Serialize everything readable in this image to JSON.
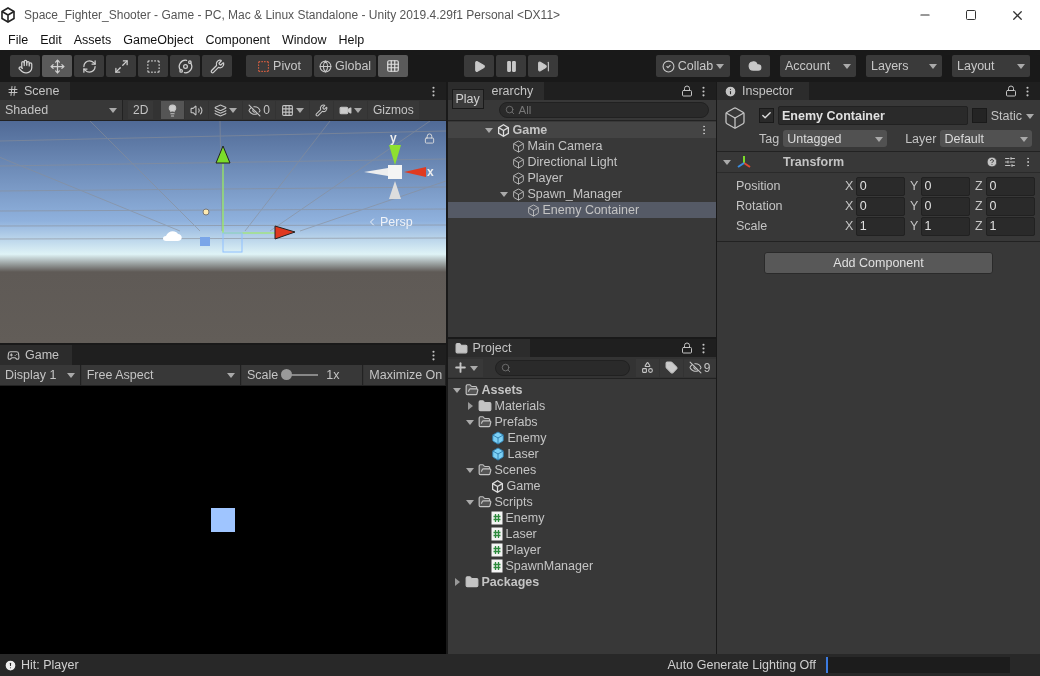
{
  "window": {
    "title": "Space_Fighter_Shooter - Game - PC, Mac & Linux Standalone - Unity 2019.4.29f1 Personal <DX11>"
  },
  "menu": [
    "File",
    "Edit",
    "Assets",
    "GameObject",
    "Component",
    "Window",
    "Help"
  ],
  "toolbar": {
    "tools": [
      {
        "kind": "hand",
        "selected": false
      },
      {
        "kind": "move",
        "selected": true
      },
      {
        "kind": "rotate",
        "selected": false
      },
      {
        "kind": "scale",
        "selected": false
      },
      {
        "kind": "rect",
        "selected": false
      },
      {
        "kind": "transform",
        "selected": false
      },
      {
        "kind": "custom",
        "selected": false
      }
    ],
    "pivot": "Pivot",
    "global": "Global",
    "snap": {
      "selected": true
    },
    "play": [
      {
        "kind": "play"
      },
      {
        "kind": "pause"
      },
      {
        "kind": "step"
      }
    ],
    "collab": "Collab",
    "account": "Account",
    "layers": "Layers",
    "layout": "Layout"
  },
  "tooltip": "Play",
  "scene": {
    "tab": "Scene",
    "shading": "Shaded",
    "mode_2d": "2D",
    "toggles": [
      {
        "kind": "lighting",
        "on": true
      },
      {
        "kind": "audio",
        "on": false
      },
      {
        "kind": "effects",
        "on": false
      },
      {
        "kind": "hidden",
        "on": false
      },
      {
        "kind": "grid",
        "on": false
      },
      {
        "kind": "tools",
        "on": false
      },
      {
        "kind": "camera",
        "on": false
      }
    ],
    "hidden_count": "0",
    "gizmos": "Gizmos",
    "axis_y": "y",
    "axis_x": "x",
    "projection": "Persp"
  },
  "game": {
    "tab": "Game",
    "display": "Display 1",
    "aspect": "Free Aspect",
    "scale_label": "Scale",
    "scale": {
      "level": 0
    },
    "scale_reading": "1x",
    "maximize": "Maximize On"
  },
  "hierarchy": {
    "tab": "erarchy",
    "search_placeholder": "All",
    "tree": [
      {
        "label": "Game",
        "kind": "scene",
        "selected": false,
        "expanded": true,
        "children": [
          {
            "label": "Main Camera",
            "kind": "object",
            "selected": false
          },
          {
            "label": "Directional Light",
            "kind": "object",
            "selected": false
          },
          {
            "label": "Player",
            "kind": "object",
            "selected": false
          },
          {
            "label": "Spawn_Manager",
            "kind": "object",
            "selected": false,
            "expanded": true,
            "children": [
              {
                "label": "Enemy Container",
                "kind": "object",
                "selected": true
              }
            ]
          }
        ]
      }
    ]
  },
  "project": {
    "tab": "Project",
    "hidden_count": "9",
    "tree": [
      {
        "label": "Assets",
        "kind": "folder",
        "selected": false,
        "expanded": true,
        "children": [
          {
            "label": "Materials",
            "kind": "folder",
            "selected": false,
            "expanded": false
          },
          {
            "label": "Prefabs",
            "kind": "folder",
            "selected": false,
            "expanded": true,
            "children": [
              {
                "label": "Enemy",
                "kind": "prefab",
                "selected": false
              },
              {
                "label": "Laser",
                "kind": "prefab",
                "selected": false
              }
            ]
          },
          {
            "label": "Scenes",
            "kind": "folder",
            "selected": false,
            "expanded": true,
            "children": [
              {
                "label": "Game",
                "kind": "scene",
                "selected": false
              }
            ]
          },
          {
            "label": "Scripts",
            "kind": "folder",
            "selected": false,
            "expanded": true,
            "children": [
              {
                "label": "Enemy",
                "kind": "script",
                "selected": false
              },
              {
                "label": "Laser",
                "kind": "script",
                "selected": false
              },
              {
                "label": "Player",
                "kind": "script",
                "selected": false
              },
              {
                "label": "SpawnManager",
                "kind": "script",
                "selected": false
              }
            ]
          }
        ]
      },
      {
        "label": "Packages",
        "kind": "folder",
        "selected": false,
        "expanded": false
      }
    ]
  },
  "inspector": {
    "tab": "Inspector",
    "active": {
      "checked": true
    },
    "name": "Enemy Container",
    "static": {
      "label": "Static",
      "checked": false
    },
    "tag_label": "Tag",
    "tag": "Untagged",
    "layer_label": "Layer",
    "layer": "Default",
    "component": {
      "title": "Transform",
      "expanded": true,
      "rows": [
        {
          "label": "Position",
          "fields": [
            {
              "axis": "X",
              "value": "0"
            },
            {
              "axis": "Y",
              "value": "0"
            },
            {
              "axis": "Z",
              "value": "0"
            }
          ]
        },
        {
          "label": "Rotation",
          "fields": [
            {
              "axis": "X",
              "value": "0"
            },
            {
              "axis": "Y",
              "value": "0"
            },
            {
              "axis": "Z",
              "value": "0"
            }
          ]
        },
        {
          "label": "Scale",
          "fields": [
            {
              "axis": "X",
              "value": "1"
            },
            {
              "axis": "Y",
              "value": "1"
            },
            {
              "axis": "Z",
              "value": "1"
            }
          ]
        }
      ]
    },
    "add_button": "Add Component"
  },
  "status_bar": {
    "message": "Hit: Player",
    "lighting": "Auto Generate Lighting Off",
    "progress": {
      "level": 0.01
    }
  }
}
